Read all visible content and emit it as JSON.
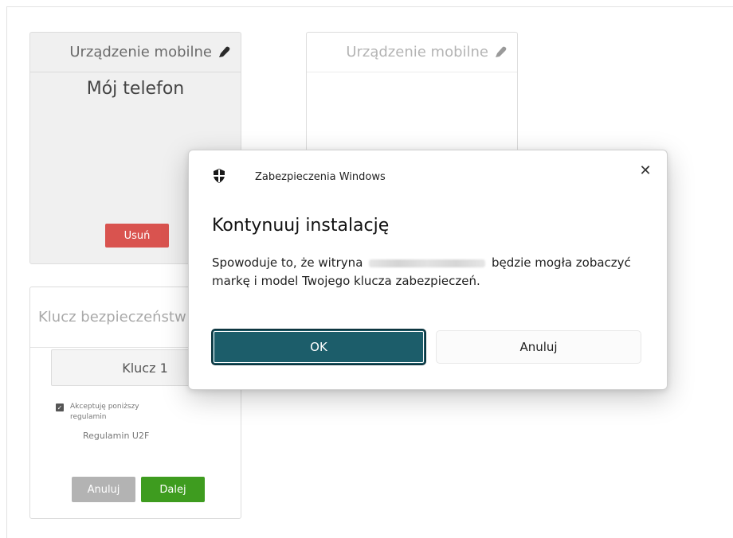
{
  "cards": {
    "device_card": {
      "header": "Urządzenie mobilne",
      "pencil_icon": "pencil-icon",
      "device_name": "Mój telefon",
      "remove_button": "Usuń"
    },
    "device_card_2": {
      "header": "Urządzenie mobilne",
      "pencil_icon": "pencil-icon"
    },
    "key_card": {
      "header": "Klucz bezpieczeństw",
      "key_name": "Klucz 1",
      "accept_label": "Akceptuję poniższy regulamin",
      "terms_link": "Regulamin U2F",
      "cancel_button": "Anuluj",
      "next_button": "Dalej"
    }
  },
  "dialog": {
    "app_name": "Zabezpieczenia Windows",
    "app_icon": "shield-icon",
    "close_icon": "close-icon",
    "close_glyph": "✕",
    "title": "Kontynuuj instalację",
    "message_before": "Spowoduje to, że witryna",
    "message_after": "będzie mogła zobaczyć markę i model Twojego klucza zabezpieczeń.",
    "ok_button": "OK",
    "cancel_button": "Anuluj"
  },
  "colors": {
    "remove_button": "#d9534f",
    "next_button": "#3e9c1f",
    "cancel_button": "#b3b3b3",
    "ok_button": "#1c5d6a"
  }
}
